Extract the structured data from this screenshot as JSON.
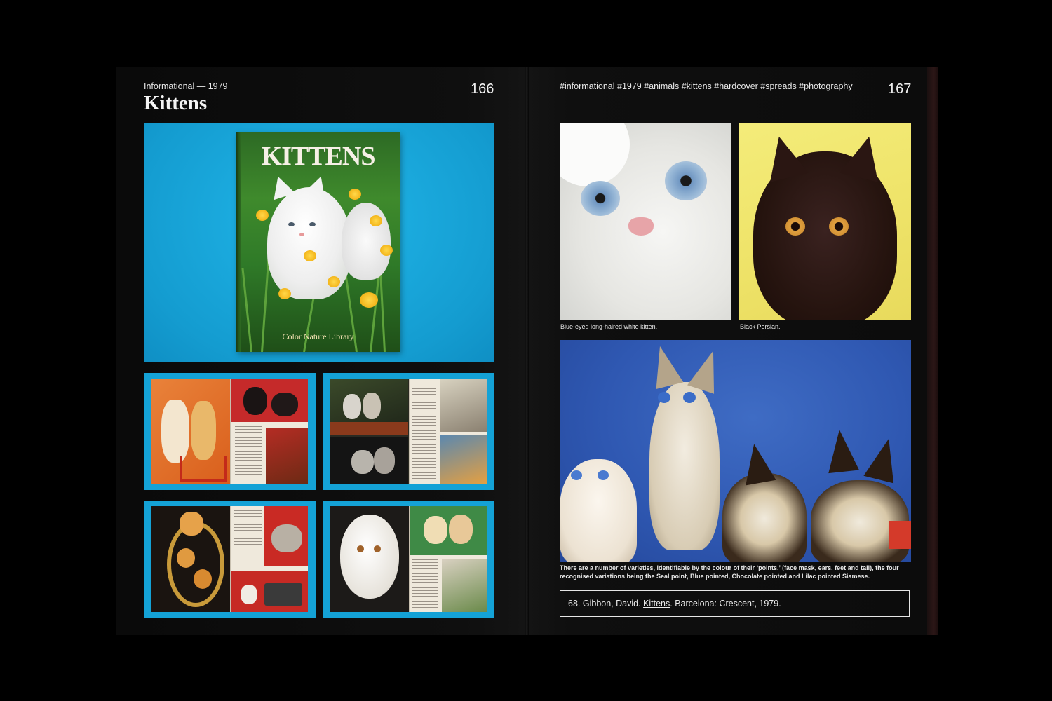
{
  "left_page": {
    "kicker": "Informational — 1979",
    "title": "Kittens",
    "page_number": "166",
    "cover": {
      "title": "KITTENS",
      "subtitle": "Color Nature Library"
    }
  },
  "right_page": {
    "tags": "#informational #1979 #animals #kittens #hardcover #spreads #photography",
    "page_number": "167",
    "captions": {
      "white_kitten": "Blue-eyed long-haired white kitten.",
      "black_persian": "Black Persian.",
      "siamese": "There are a number of varieties, identifiable by the colour of their ‘points,’ (face mask, ears, feet and tail), the four recognised variations being the Seal point, Blue pointed, Chocolate pointed and Lilac pointed Siamese."
    },
    "citation": {
      "number": "68.",
      "before": "Gibbon, David. ",
      "book_title": "Kittens",
      "after": ". Barcelona: Crescent, 1979."
    }
  },
  "colors": {
    "background": "#000000",
    "page": "#0d0d0d",
    "accent_blue": "#19a3d6"
  }
}
